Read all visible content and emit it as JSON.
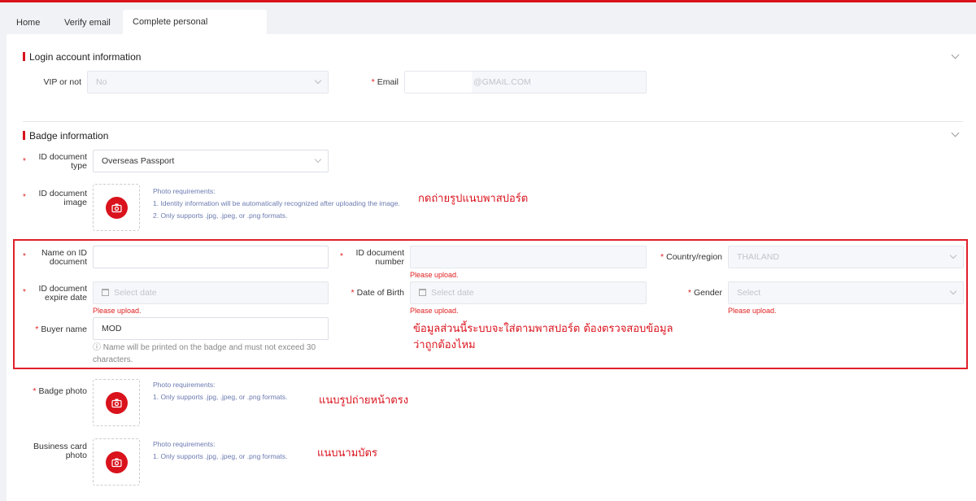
{
  "tabs": [
    {
      "label": "Home"
    },
    {
      "label": "Verify email"
    },
    {
      "label": "Complete personal information",
      "close": "×"
    }
  ],
  "login_section": {
    "title": "Login account information",
    "vip_label": "VIP or not",
    "vip_value": "No",
    "email_label": "Email",
    "email_value": "@GMAIL.COM"
  },
  "badge_section": {
    "title": "Badge information",
    "id_type_label": "ID document type",
    "id_type_value": "Overseas Passport",
    "id_image_label": "ID document image",
    "id_image_req_title": "Photo requirements:",
    "id_image_req_1": "1. Identity information will be automatically recognized after uploading the image.",
    "id_image_req_2": "2. Only supports .jpg, .jpeg, or .png formats.",
    "name_label": "Name on ID document",
    "id_number_label": "ID document number",
    "id_number_error": "Please upload.",
    "country_label": "Country/region",
    "country_value": "THAILAND",
    "expire_label": "ID document expire date",
    "expire_placeholder": "Select date",
    "expire_error": "Please upload.",
    "dob_label": "Date of Birth",
    "dob_placeholder": "Select date",
    "dob_error": "Please upload.",
    "gender_label": "Gender",
    "gender_placeholder": "Select",
    "gender_error": "Please upload.",
    "buyer_label": "Buyer name",
    "buyer_value": "MOD",
    "buyer_hint": "ⓘ Name will be printed on the badge and must not exceed 30 characters.",
    "badge_photo_label": "Badge photo",
    "badge_photo_req_title": "Photo requirements:",
    "badge_photo_req_1": "1. Only supports .jpg, .jpeg, or .png formats.",
    "card_photo_label": "Business card photo",
    "card_photo_req_title": "Photo requirements:",
    "card_photo_req_1": "1. Only supports .jpg, .jpeg, or .png formats."
  },
  "annotations": {
    "passport_note": "กดถ่ายรูปแนบพาสปอร์ต",
    "auto_fill_note_1": "ข้อมูลส่วนนี้ระบบจะใส่ตามพาสปอร์ต ต้องตรวจสอบข้อมูล",
    "auto_fill_note_2": "ว่าถูกต้องไหม",
    "badge_note": "แนบรูปถ่ายหน้าตรง",
    "card_note": "แนบนามบัตร"
  },
  "colors": {
    "accent": "#d9121c",
    "error": "#e02020",
    "requirement_text": "#6b7ab0"
  },
  "icons": {
    "upload": "camera-icon",
    "dropdown": "chevron-down-icon",
    "date": "calendar-icon"
  }
}
